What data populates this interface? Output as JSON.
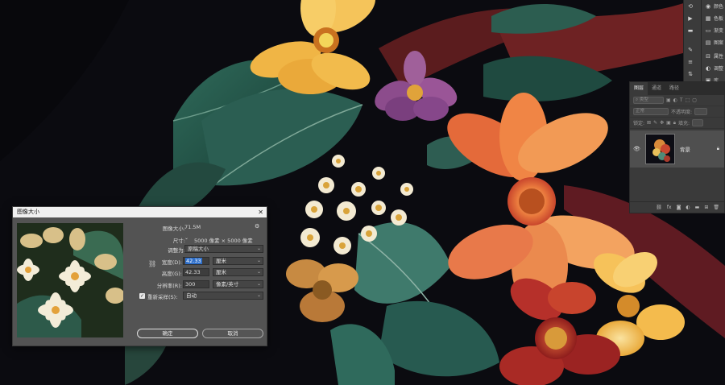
{
  "panels_strip": {
    "items": [
      {
        "icon": "history-icon",
        "label": ""
      },
      {
        "icon": "play-icon",
        "label": ""
      },
      {
        "icon": "comment-icon",
        "label": ""
      },
      {
        "icon": "brush-settings-icon",
        "label": ""
      },
      {
        "icon": "adjustments-sliders-icon",
        "label": ""
      },
      {
        "icon": "sort-icon",
        "label": ""
      }
    ],
    "labels": [
      {
        "icon": "color-icon",
        "label": "颜色"
      },
      {
        "icon": "swatches-icon",
        "label": "色板"
      },
      {
        "icon": "gradient-icon",
        "label": "渐变"
      },
      {
        "icon": "patterns-icon",
        "label": "图案"
      },
      {
        "icon": "properties-icon",
        "label": "属性"
      },
      {
        "icon": "adjustments-icon",
        "label": "调整"
      },
      {
        "icon": "libraries-icon",
        "label": "库"
      }
    ]
  },
  "layers_panel": {
    "tabs": [
      "图层",
      "通道",
      "路径"
    ],
    "active_tab": "图层",
    "filter_kind": "类型",
    "blend_mode": "正常",
    "opacity_label": "不透明度:",
    "lock_label": "锁定:",
    "fill_label": "填充:",
    "layer": {
      "name": "背景",
      "visible": true,
      "locked": true
    }
  },
  "dialog": {
    "title": "图像大小",
    "image_size_label": "图像大小:",
    "image_size_value": "71.5M",
    "dimensions_label": "尺寸:",
    "dimensions_value": "5000 像素 × 5000 像素",
    "fit_to_label": "调整为:",
    "fit_to_value": "原稿大小",
    "width_label": "宽度(D):",
    "width_value": "42.33",
    "width_unit": "厘米",
    "height_label": "高度(G):",
    "height_value": "42.33",
    "height_unit": "厘米",
    "resolution_label": "分辨率(R):",
    "resolution_value": "300",
    "resolution_unit": "像素/英寸",
    "resample_label": "重新采样(S):",
    "resample_checked": true,
    "resample_value": "自动",
    "ok_label": "确定",
    "cancel_label": "取消"
  }
}
